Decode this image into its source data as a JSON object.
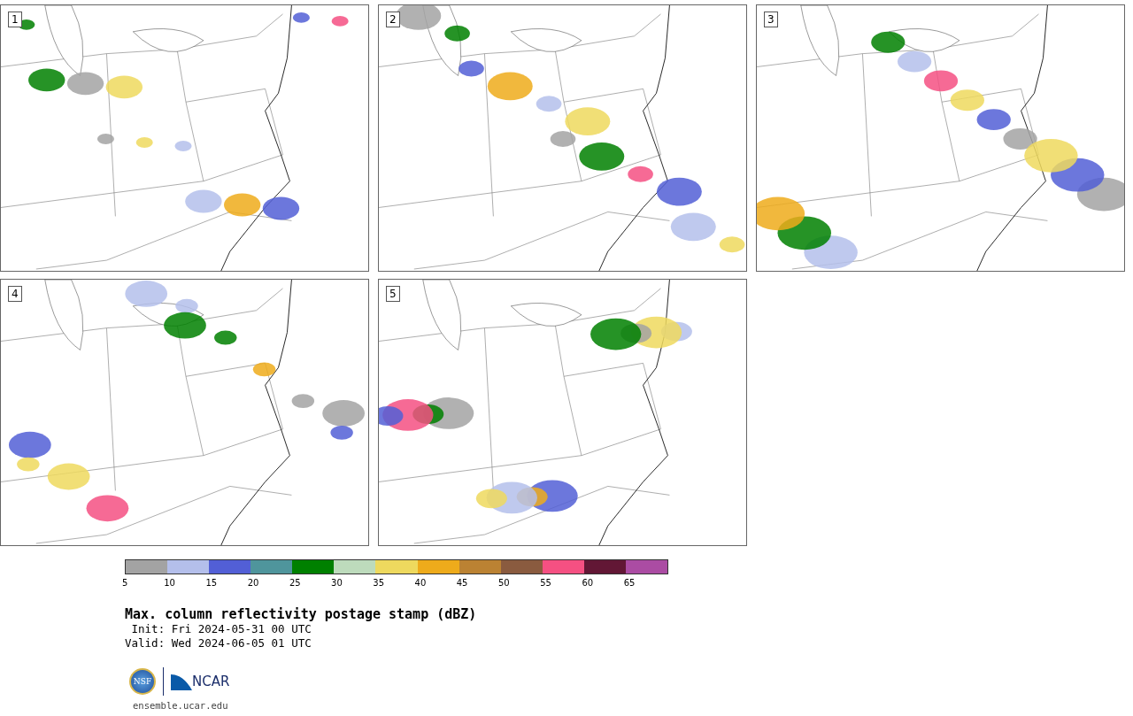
{
  "panels": [
    {
      "number": "1"
    },
    {
      "number": "2"
    },
    {
      "number": "3"
    },
    {
      "number": "4"
    },
    {
      "number": "5"
    }
  ],
  "colorbar": {
    "segments": [
      {
        "color": "#a3a3a3"
      },
      {
        "color": "#b4bfeb"
      },
      {
        "color": "#525fd6"
      },
      {
        "color": "#4f959c"
      },
      {
        "color": "#008000"
      },
      {
        "color": "#bddbbc"
      },
      {
        "color": "#eed95e"
      },
      {
        "color": "#eeab1b"
      },
      {
        "color": "#bb8233"
      },
      {
        "color": "#8a5b3f"
      },
      {
        "color": "#f55082"
      },
      {
        "color": "#621735"
      },
      {
        "color": "#ab4ca3"
      }
    ],
    "ticks": [
      "5",
      "10",
      "15",
      "20",
      "25",
      "30",
      "35",
      "40",
      "45",
      "50",
      "55",
      "60",
      "65"
    ]
  },
  "title": "Max. column reflectivity postage stamp (dBZ)",
  "init": " Init: Fri 2024-05-31 00 UTC",
  "valid": "Valid: Wed 2024-06-05 01 UTC",
  "logo": {
    "left": "NSF",
    "right": "NCAR"
  },
  "footer": "ensemble.ucar.edu"
}
